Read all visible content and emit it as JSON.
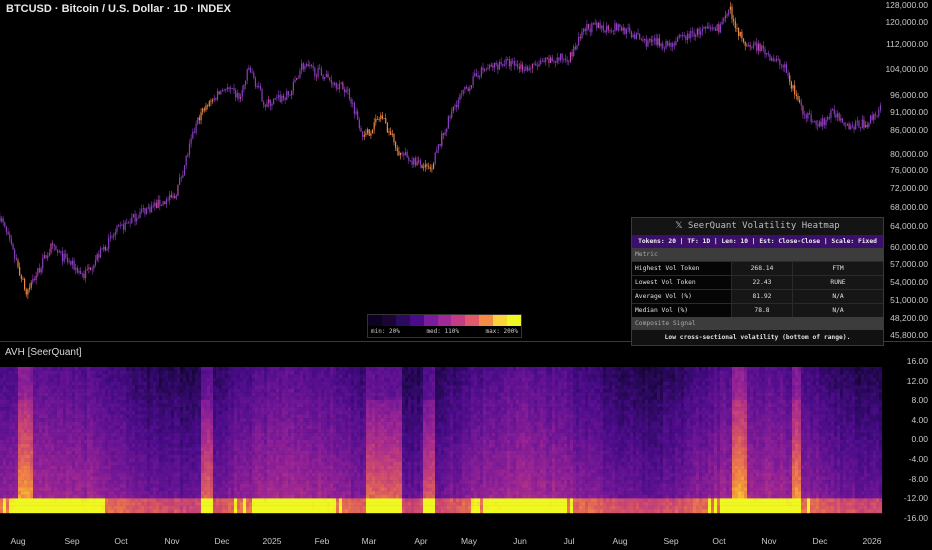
{
  "header": {
    "title": "BTCUSD · Bitcoin / U.S. Dollar · 1D · INDEX"
  },
  "indicator": {
    "title": "AVH [SeerQuant]"
  },
  "price_axis": [
    "128,000.00",
    "120,000.00",
    "112,000.00",
    "104,000.00",
    "96,000.00",
    "91,000.00",
    "86,000.00",
    "80,000.00",
    "76,000.00",
    "72,000.00",
    "68,000.00",
    "64,000.00",
    "60,000.00",
    "57,000.00",
    "54,000.00",
    "51,000.00",
    "48,200.00",
    "45,800.00"
  ],
  "heat_axis": [
    "16.00",
    "12.00",
    "8.00",
    "4.00",
    "0.00",
    "-4.00",
    "-8.00",
    "-12.00",
    "-16.00"
  ],
  "time_axis": [
    "Aug",
    "Sep",
    "Oct",
    "Nov",
    "Dec",
    "2025",
    "Feb",
    "Mar",
    "Apr",
    "May",
    "Jun",
    "Jul",
    "Aug",
    "Sep",
    "Oct",
    "Nov",
    "Dec",
    "2026"
  ],
  "table": {
    "title": "𝕏 SeerQuant Volatility Heatmap",
    "subtitle": "Tokens: 20 | TF: 1D | Len: 10 | Est: Close-Close | Scale: Fixed",
    "metric_header": "Metric",
    "rows": [
      {
        "metric": "Highest Vol Token",
        "value": "268.14",
        "token": "FTM"
      },
      {
        "metric": "Lowest Vol Token",
        "value": "22.43",
        "token": "RUNE"
      },
      {
        "metric": "Average Vol (%)",
        "value": "81.92",
        "token": "N/A"
      },
      {
        "metric": "Median Vol (%)",
        "value": "78.8",
        "token": "N/A"
      }
    ],
    "signal_header": "Composite Signal",
    "signal": "Low cross-sectional volatility (bottom of range)."
  },
  "legend": {
    "min": "min: 20%",
    "med": "med: 110%",
    "max": "max: 200%",
    "colors": [
      "#0d0221",
      "#1a0633",
      "#2c0a5e",
      "#4a0c8a",
      "#7a1c9e",
      "#a02a9a",
      "#c43c86",
      "#e05a6a",
      "#f48a48",
      "#fbd33a",
      "#f0f921"
    ]
  },
  "chart_data": {
    "type": "candlestick+heatmap",
    "symbol": "BTCUSD",
    "price_keypoints_day_price": [
      [
        -11,
        66000
      ],
      [
        5,
        52000
      ],
      [
        20,
        60000
      ],
      [
        40,
        55000
      ],
      [
        60,
        63000
      ],
      [
        75,
        67000
      ],
      [
        95,
        70000
      ],
      [
        100,
        76000
      ],
      [
        110,
        90000
      ],
      [
        125,
        98000
      ],
      [
        135,
        95000
      ],
      [
        140,
        104000
      ],
      [
        150,
        93000
      ],
      [
        165,
        96000
      ],
      [
        172,
        105000
      ],
      [
        185,
        102000
      ],
      [
        200,
        97000
      ],
      [
        210,
        84000
      ],
      [
        220,
        90000
      ],
      [
        232,
        80000
      ],
      [
        250,
        76000
      ],
      [
        265,
        93000
      ],
      [
        280,
        103000
      ],
      [
        295,
        106000
      ],
      [
        310,
        104000
      ],
      [
        320,
        106000
      ],
      [
        335,
        108000
      ],
      [
        345,
        118000
      ],
      [
        365,
        118000
      ],
      [
        380,
        113000
      ],
      [
        395,
        112000
      ],
      [
        410,
        116000
      ],
      [
        425,
        118000
      ],
      [
        432,
        124000
      ],
      [
        440,
        112000
      ],
      [
        450,
        111000
      ],
      [
        465,
        104000
      ],
      [
        475,
        92000
      ],
      [
        485,
        87000
      ],
      [
        495,
        91000
      ],
      [
        505,
        87000
      ],
      [
        515,
        88000
      ],
      [
        523,
        92000
      ]
    ],
    "high_vol_days": [
      [
        0,
        8
      ],
      [
        110,
        118
      ],
      [
        210,
        232
      ],
      [
        245,
        252
      ],
      [
        432,
        442
      ],
      [
        468,
        474
      ]
    ],
    "heat_ylim": [
      -16,
      16
    ],
    "price_ylim": [
      45800,
      128000
    ],
    "colors": {
      "candle": "#8a3fc0",
      "hot": "#f08a48"
    }
  }
}
